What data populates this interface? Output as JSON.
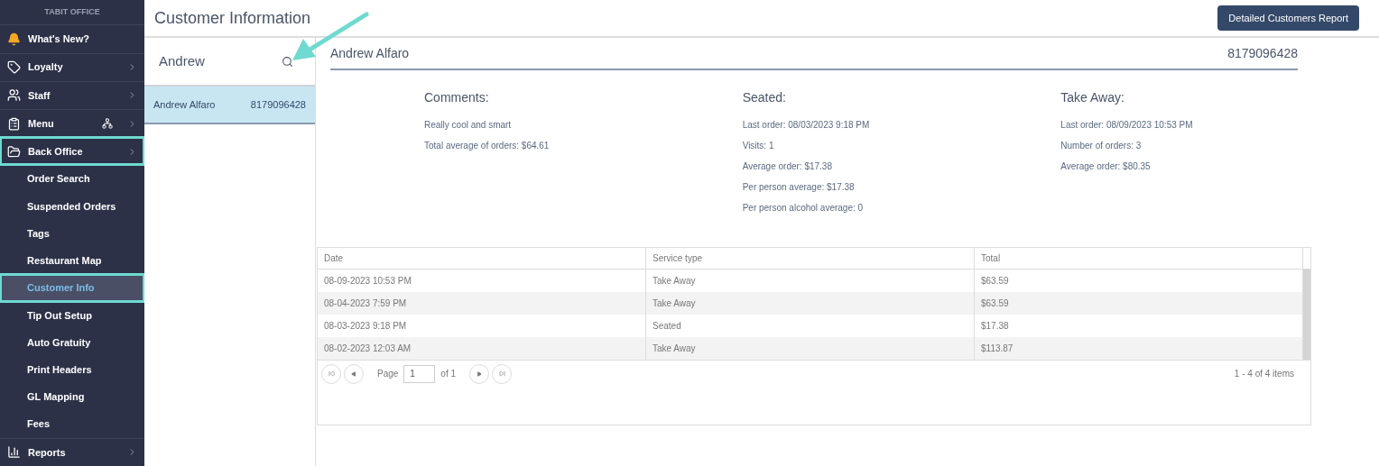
{
  "sidebar": {
    "brand": "TABIT OFFICE",
    "items": [
      {
        "kind": "section",
        "label": "What's New?",
        "chevron": false,
        "extra_icon": false,
        "selected": false,
        "highlighted": false
      },
      {
        "kind": "section",
        "label": "Loyalty",
        "chevron": true,
        "extra_icon": false,
        "selected": false,
        "highlighted": false
      },
      {
        "kind": "section",
        "label": "Staff",
        "chevron": true,
        "extra_icon": false,
        "selected": false,
        "highlighted": false
      },
      {
        "kind": "section",
        "label": "Menu",
        "chevron": true,
        "extra_icon": true,
        "selected": false,
        "highlighted": false
      },
      {
        "kind": "section",
        "label": "Back Office",
        "chevron": true,
        "extra_icon": false,
        "selected": false,
        "highlighted": true
      },
      {
        "kind": "sub",
        "label": "Order Search",
        "selected": false,
        "highlighted": false
      },
      {
        "kind": "sub",
        "label": "Suspended Orders",
        "selected": false,
        "highlighted": false
      },
      {
        "kind": "sub",
        "label": "Tags",
        "selected": false,
        "highlighted": false
      },
      {
        "kind": "sub",
        "label": "Restaurant Map",
        "selected": false,
        "highlighted": false
      },
      {
        "kind": "sub",
        "label": "Customer Info",
        "selected": true,
        "highlighted": true
      },
      {
        "kind": "sub",
        "label": "Tip Out Setup",
        "selected": false,
        "highlighted": false
      },
      {
        "kind": "sub",
        "label": "Auto Gratuity",
        "selected": false,
        "highlighted": false
      },
      {
        "kind": "sub",
        "label": "Print Headers",
        "selected": false,
        "highlighted": false
      },
      {
        "kind": "sub",
        "label": "GL Mapping",
        "selected": false,
        "highlighted": false
      },
      {
        "kind": "sub",
        "label": "Fees",
        "selected": false,
        "highlighted": false
      },
      {
        "kind": "section",
        "label": "Reports",
        "chevron": true,
        "extra_icon": false,
        "selected": false,
        "highlighted": false
      }
    ]
  },
  "page": {
    "title": "Customer Information",
    "report_button": "Detailed Customers Report"
  },
  "search": {
    "value": "Andrew"
  },
  "results": [
    {
      "name": "Andrew Alfaro",
      "phone": "8179096428",
      "selected": true
    }
  ],
  "customer": {
    "name": "Andrew Alfaro",
    "phone": "8179096428",
    "sections": [
      {
        "title": "Comments:",
        "lines": [
          "Really cool and smart",
          "Total average of orders: $64.61"
        ]
      },
      {
        "title": "Seated:",
        "lines": [
          "Last order: 08/03/2023 9:18 PM",
          "Visits: 1",
          "Average order: $17.38",
          "Per person average: $17.38",
          "Per person alcohol average: 0"
        ]
      },
      {
        "title": "Take Away:",
        "lines": [
          "Last order: 08/09/2023 10:53 PM",
          "Number of orders: 3",
          "Average order: $80.35"
        ]
      }
    ]
  },
  "table": {
    "columns": [
      "Date",
      "Service type",
      "Total"
    ],
    "rows": [
      [
        "08-09-2023 10:53 PM",
        "Take Away",
        "$63.59"
      ],
      [
        "08-04-2023 7:59 PM",
        "Take Away",
        "$63.59"
      ],
      [
        "08-03-2023 9:18 PM",
        "Seated",
        "$17.38"
      ],
      [
        "08-02-2023 12:03 AM",
        "Take Away",
        "$113.87"
      ]
    ]
  },
  "pager": {
    "page_label": "Page",
    "page": "1",
    "of": "of 1",
    "summary": "1 - 4 of 4 items"
  },
  "annotation_arrow": true
}
